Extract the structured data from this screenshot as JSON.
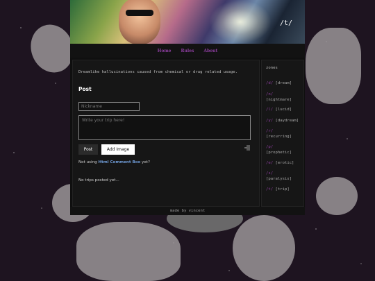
{
  "header": {
    "title": "/t/"
  },
  "nav": [
    "Home",
    "Rules",
    "About"
  ],
  "main": {
    "description": "Dreamlike hallucinations caused from chemical or drug related usage.",
    "post_heading": "Post",
    "nickname_placeholder": "Nickname",
    "trip_placeholder": "Write your trip here!",
    "post_button": "Post",
    "add_image_button": "Add Image",
    "not_using_prefix": "Not using ",
    "not_using_link": "Html Comment Box",
    "not_using_suffix": " yet?",
    "no_trips": "No trips posted yet..."
  },
  "sidebar": {
    "heading": "zones",
    "zones": [
      {
        "code": "/d/",
        "label": "[dream]"
      },
      {
        "code": "/n/",
        "label": "[nightmare]"
      },
      {
        "code": "/l/",
        "label": "[lucid]"
      },
      {
        "code": "/y/",
        "label": "[daydream]"
      },
      {
        "code": "/r/",
        "label": "[recurring]"
      },
      {
        "code": "/p/",
        "label": "[prophetic]"
      },
      {
        "code": "/e/",
        "label": "[erotic]"
      },
      {
        "code": "/s/",
        "label": "[paralysis]"
      },
      {
        "code": "/t/",
        "label": "[trip]"
      }
    ]
  },
  "footer": {
    "text": "made by vincent"
  },
  "colors": {
    "accent": "#8d3ea0",
    "link": "#6f9bd6",
    "background": "#1e1420"
  },
  "icons": [
    "door-icon"
  ]
}
